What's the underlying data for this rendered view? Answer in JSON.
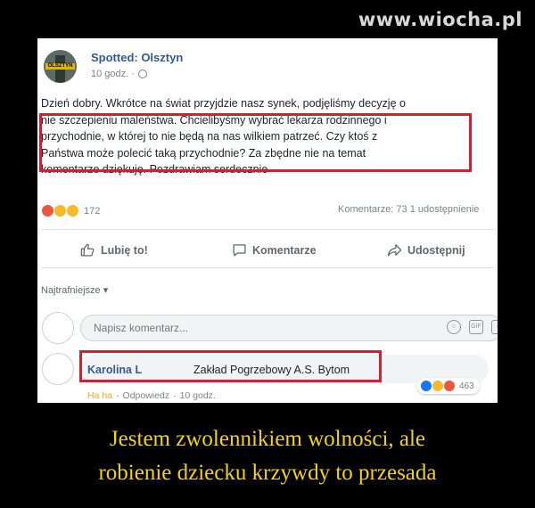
{
  "watermark": "www.wiocha.pl",
  "post": {
    "page_name": "Spotted: Olsztyn",
    "avatar_text": "OLSZTYN",
    "time": "10 godz. ·",
    "lines": [
      "Dzień dobry. Wkrótce na świat przyjdzie nasz synek, podjęliśmy decyzję o",
      "nie szczepieniu maleństwa. Chcielibyśmy wybrać lekarza rodzinnego i",
      "przychodnie, w której to nie będą na nas wilkiem patrzeć. Czy ktoś z",
      "Państwa może polecić taką przychodnie? Za zbędne nie na temat",
      "komentarze dziękuję. Pozdrawiam serdecznie"
    ],
    "reaction_count": "172",
    "stats": "Komentarze: 73   1 udostępnienie"
  },
  "actions": {
    "like": "Lubię to!",
    "comment": "Komentarze",
    "share": "Udostępnij"
  },
  "comments": {
    "sort_label": "Najtrafniejsze",
    "input_placeholder": "Napisz komentarz...",
    "gif_label": "GIF",
    "items": [
      {
        "author": "Karolina L",
        "text": "Zakład Pogrzebowy A.S. Bytom",
        "reaction_link": "Ha ha",
        "reply_link": "Odpowiedz",
        "time": "10 godz.",
        "reaction_count": "463"
      }
    ]
  },
  "caption": {
    "line1": "Jestem zwolennikiem wolności, ale",
    "line2": "robienie dziecku krzywdy to przesada"
  },
  "colors": {
    "link_blue": "#365899",
    "highlight_red": "#d32030",
    "caption_yellow": "#f2d316"
  }
}
